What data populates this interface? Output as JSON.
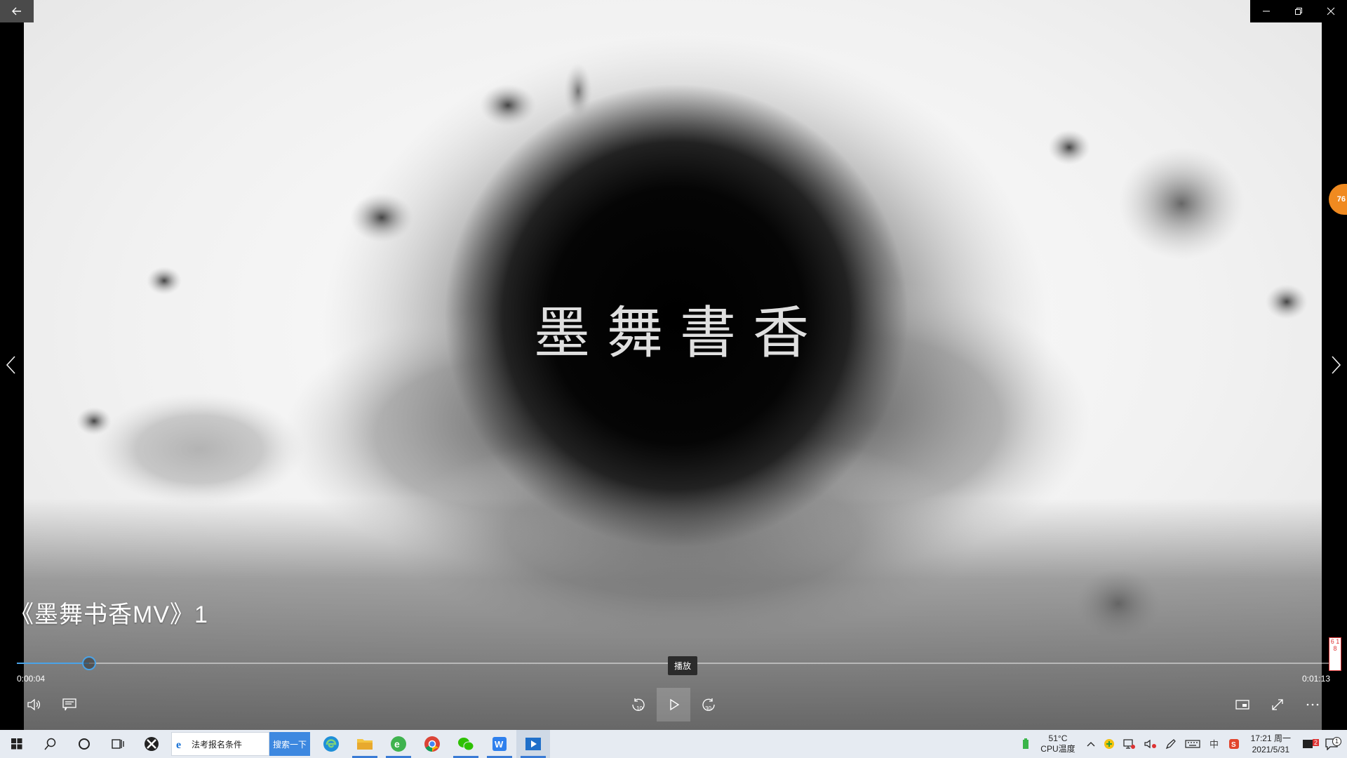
{
  "video": {
    "calligraphy": "墨舞書香",
    "title": "《墨舞书香MV》1"
  },
  "player": {
    "current_time": "0:00:04",
    "total_time": "0:01:13",
    "progress": 0.055,
    "tooltip": "播放",
    "skip_back_label": "10",
    "skip_forward_label": "30"
  },
  "side": {
    "badge": "76",
    "note": "6 1 8"
  },
  "taskbar": {
    "search_text": "法考报名条件",
    "search_button": "搜索一下",
    "cpu_temp": "51°C",
    "cpu_label": "CPU温度",
    "time": "17:21 周一",
    "date": "2021/5/31",
    "notification_count": "1",
    "sogou_badge": "2"
  },
  "colors": {
    "accent": "#4aa3e8",
    "taskbar_bg": "#e6ebf2",
    "search_btn": "#3d88e0"
  }
}
